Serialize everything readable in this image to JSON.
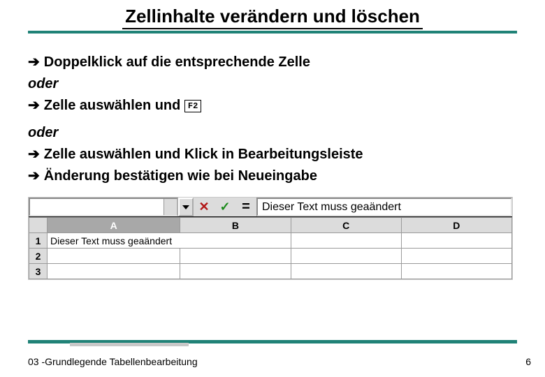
{
  "title": "Zellinhalte verändern und löschen",
  "bullets": {
    "b1": "Doppelklick auf die entsprechende Zelle",
    "oder1": "oder",
    "b2_pre": "Zelle auswählen und ",
    "b2_key": "F2",
    "oder2": "oder",
    "b3": "Zelle auswählen und Klick in Bearbeitungsleiste",
    "b4": "Änderung bestätigen wie bei Neueingabe"
  },
  "arrow_glyph": "➔",
  "spreadsheet": {
    "formula_text": "Dieser Text muss geaändert",
    "columns": [
      "A",
      "B",
      "C",
      "D"
    ],
    "selected_col": "A",
    "rows": [
      "1",
      "2",
      "3"
    ],
    "cell_a1": "Dieser Text muss geaändert"
  },
  "footer": {
    "left": "03 -Grundlegende Tabellenbearbeitung",
    "right": "6"
  }
}
